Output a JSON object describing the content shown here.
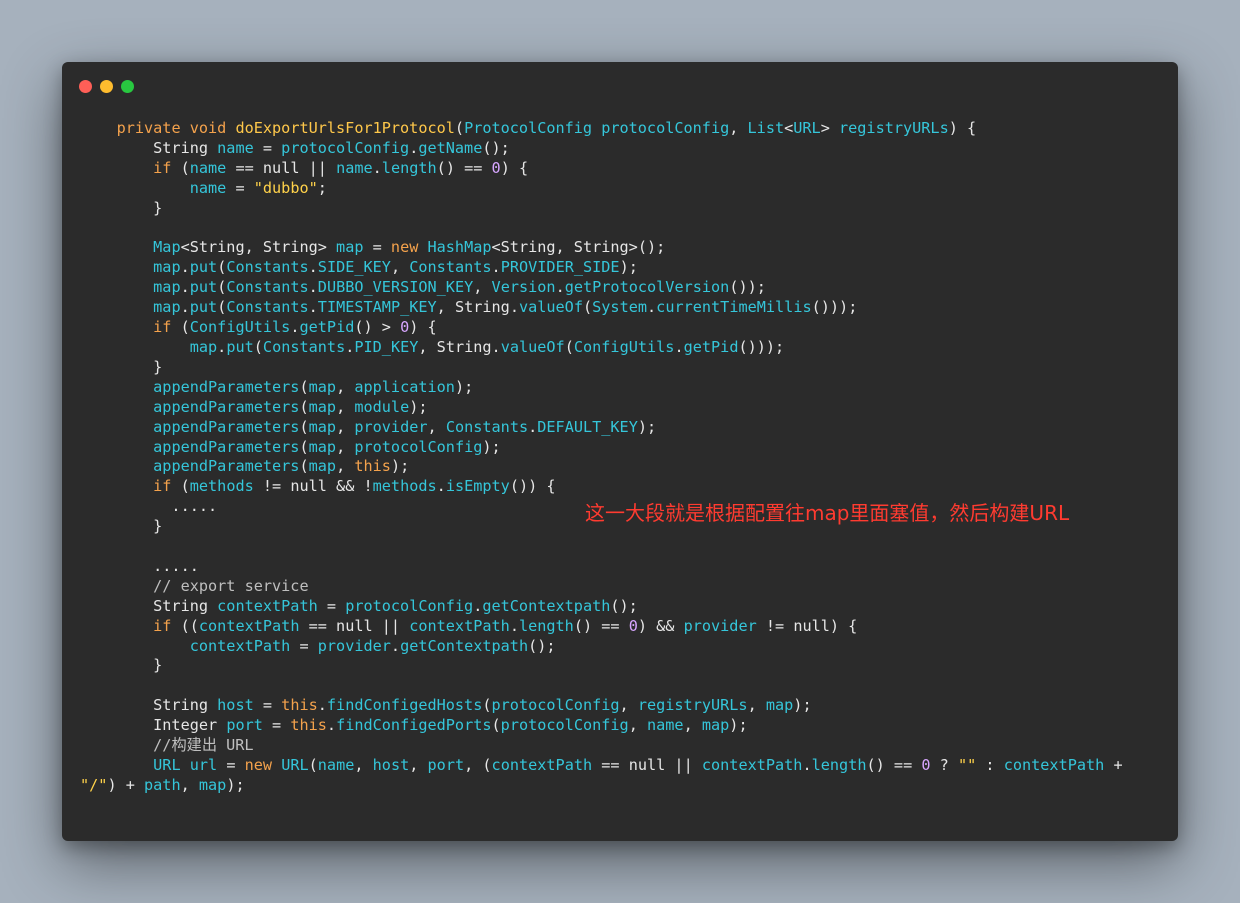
{
  "window": {
    "dots": [
      {
        "name": "close-dot",
        "color": "#ff5f57"
      },
      {
        "name": "minimize-dot",
        "color": "#febc2e"
      },
      {
        "name": "maximize-dot",
        "color": "#28c840"
      }
    ]
  },
  "annotation": "这一大段就是根据配置往map里面塞值，然后构建URL",
  "code_lines": [
    [
      [
        "p",
        "    "
      ],
      [
        "k",
        "private void "
      ],
      [
        "f",
        "doExportUrlsFor1Protocol"
      ],
      [
        "p",
        "("
      ],
      [
        "t",
        "ProtocolConfig protocolConfig"
      ],
      [
        "p",
        ", "
      ],
      [
        "t",
        "List"
      ],
      [
        "p",
        "<"
      ],
      [
        "t",
        "URL"
      ],
      [
        "p",
        "> "
      ],
      [
        "t",
        "registryURLs"
      ],
      [
        "p",
        ") {"
      ]
    ],
    [
      [
        "p",
        "        String "
      ],
      [
        "t",
        "name"
      ],
      [
        "p",
        " = "
      ],
      [
        "t",
        "protocolConfig"
      ],
      [
        "p",
        "."
      ],
      [
        "t",
        "getName"
      ],
      [
        "p",
        "();"
      ]
    ],
    [
      [
        "p",
        "        "
      ],
      [
        "k",
        "if"
      ],
      [
        "p",
        " ("
      ],
      [
        "t",
        "name"
      ],
      [
        "p",
        " == null || "
      ],
      [
        "t",
        "name"
      ],
      [
        "p",
        "."
      ],
      [
        "t",
        "length"
      ],
      [
        "p",
        "() == "
      ],
      [
        "n",
        "0"
      ],
      [
        "p",
        ") {"
      ]
    ],
    [
      [
        "p",
        "            "
      ],
      [
        "t",
        "name"
      ],
      [
        "p",
        " = "
      ],
      [
        "s",
        "\"dubbo\""
      ],
      [
        "p",
        ";"
      ]
    ],
    [
      [
        "p",
        "        }"
      ]
    ],
    [
      [
        "p",
        ""
      ]
    ],
    [
      [
        "p",
        "        "
      ],
      [
        "t",
        "Map"
      ],
      [
        "p",
        "<String, String> "
      ],
      [
        "t",
        "map"
      ],
      [
        "p",
        " = "
      ],
      [
        "k",
        "new "
      ],
      [
        "t",
        "HashMap"
      ],
      [
        "p",
        "<String, String>();"
      ]
    ],
    [
      [
        "p",
        "        "
      ],
      [
        "t",
        "map"
      ],
      [
        "p",
        "."
      ],
      [
        "t",
        "put"
      ],
      [
        "p",
        "("
      ],
      [
        "t",
        "Constants"
      ],
      [
        "p",
        "."
      ],
      [
        "t",
        "SIDE_KEY"
      ],
      [
        "p",
        ", "
      ],
      [
        "t",
        "Constants"
      ],
      [
        "p",
        "."
      ],
      [
        "t",
        "PROVIDER_SIDE"
      ],
      [
        "p",
        ");"
      ]
    ],
    [
      [
        "p",
        "        "
      ],
      [
        "t",
        "map"
      ],
      [
        "p",
        "."
      ],
      [
        "t",
        "put"
      ],
      [
        "p",
        "("
      ],
      [
        "t",
        "Constants"
      ],
      [
        "p",
        "."
      ],
      [
        "t",
        "DUBBO_VERSION_KEY"
      ],
      [
        "p",
        ", "
      ],
      [
        "t",
        "Version"
      ],
      [
        "p",
        "."
      ],
      [
        "t",
        "getProtocolVersion"
      ],
      [
        "p",
        "());"
      ]
    ],
    [
      [
        "p",
        "        "
      ],
      [
        "t",
        "map"
      ],
      [
        "p",
        "."
      ],
      [
        "t",
        "put"
      ],
      [
        "p",
        "("
      ],
      [
        "t",
        "Constants"
      ],
      [
        "p",
        "."
      ],
      [
        "t",
        "TIMESTAMP_KEY"
      ],
      [
        "p",
        ", String."
      ],
      [
        "t",
        "valueOf"
      ],
      [
        "p",
        "("
      ],
      [
        "t",
        "System"
      ],
      [
        "p",
        "."
      ],
      [
        "t",
        "currentTimeMillis"
      ],
      [
        "p",
        "()));"
      ]
    ],
    [
      [
        "p",
        "        "
      ],
      [
        "k",
        "if"
      ],
      [
        "p",
        " ("
      ],
      [
        "t",
        "ConfigUtils"
      ],
      [
        "p",
        "."
      ],
      [
        "t",
        "getPid"
      ],
      [
        "p",
        "() > "
      ],
      [
        "n",
        "0"
      ],
      [
        "p",
        ") {"
      ]
    ],
    [
      [
        "p",
        "            "
      ],
      [
        "t",
        "map"
      ],
      [
        "p",
        "."
      ],
      [
        "t",
        "put"
      ],
      [
        "p",
        "("
      ],
      [
        "t",
        "Constants"
      ],
      [
        "p",
        "."
      ],
      [
        "t",
        "PID_KEY"
      ],
      [
        "p",
        ", String."
      ],
      [
        "t",
        "valueOf"
      ],
      [
        "p",
        "("
      ],
      [
        "t",
        "ConfigUtils"
      ],
      [
        "p",
        "."
      ],
      [
        "t",
        "getPid"
      ],
      [
        "p",
        "()));"
      ]
    ],
    [
      [
        "p",
        "        }"
      ]
    ],
    [
      [
        "p",
        "        "
      ],
      [
        "t",
        "appendParameters"
      ],
      [
        "p",
        "("
      ],
      [
        "t",
        "map"
      ],
      [
        "p",
        ", "
      ],
      [
        "t",
        "application"
      ],
      [
        "p",
        ");"
      ]
    ],
    [
      [
        "p",
        "        "
      ],
      [
        "t",
        "appendParameters"
      ],
      [
        "p",
        "("
      ],
      [
        "t",
        "map"
      ],
      [
        "p",
        ", "
      ],
      [
        "t",
        "module"
      ],
      [
        "p",
        ");"
      ]
    ],
    [
      [
        "p",
        "        "
      ],
      [
        "t",
        "appendParameters"
      ],
      [
        "p",
        "("
      ],
      [
        "t",
        "map"
      ],
      [
        "p",
        ", "
      ],
      [
        "t",
        "provider"
      ],
      [
        "p",
        ", "
      ],
      [
        "t",
        "Constants"
      ],
      [
        "p",
        "."
      ],
      [
        "t",
        "DEFAULT_KEY"
      ],
      [
        "p",
        ");"
      ]
    ],
    [
      [
        "p",
        "        "
      ],
      [
        "t",
        "appendParameters"
      ],
      [
        "p",
        "("
      ],
      [
        "t",
        "map"
      ],
      [
        "p",
        ", "
      ],
      [
        "t",
        "protocolConfig"
      ],
      [
        "p",
        ");"
      ]
    ],
    [
      [
        "p",
        "        "
      ],
      [
        "t",
        "appendParameters"
      ],
      [
        "p",
        "("
      ],
      [
        "t",
        "map"
      ],
      [
        "p",
        ", "
      ],
      [
        "k",
        "this"
      ],
      [
        "p",
        ");"
      ]
    ],
    [
      [
        "p",
        "        "
      ],
      [
        "k",
        "if"
      ],
      [
        "p",
        " ("
      ],
      [
        "t",
        "methods"
      ],
      [
        "p",
        " != null && !"
      ],
      [
        "t",
        "methods"
      ],
      [
        "p",
        "."
      ],
      [
        "t",
        "isEmpty"
      ],
      [
        "p",
        "()) {"
      ]
    ],
    [
      [
        "p",
        "          ....."
      ]
    ],
    [
      [
        "p",
        "        }"
      ]
    ],
    [
      [
        "p",
        ""
      ]
    ],
    [
      [
        "p",
        "        ....."
      ]
    ],
    [
      [
        "p",
        "        "
      ],
      [
        "c",
        "// export service"
      ]
    ],
    [
      [
        "p",
        "        String "
      ],
      [
        "t",
        "contextPath"
      ],
      [
        "p",
        " = "
      ],
      [
        "t",
        "protocolConfig"
      ],
      [
        "p",
        "."
      ],
      [
        "t",
        "getContextpath"
      ],
      [
        "p",
        "();"
      ]
    ],
    [
      [
        "p",
        "        "
      ],
      [
        "k",
        "if"
      ],
      [
        "p",
        " (("
      ],
      [
        "t",
        "contextPath"
      ],
      [
        "p",
        " == null || "
      ],
      [
        "t",
        "contextPath"
      ],
      [
        "p",
        "."
      ],
      [
        "t",
        "length"
      ],
      [
        "p",
        "() == "
      ],
      [
        "n",
        "0"
      ],
      [
        "p",
        ") && "
      ],
      [
        "t",
        "provider"
      ],
      [
        "p",
        " != null) {"
      ]
    ],
    [
      [
        "p",
        "            "
      ],
      [
        "t",
        "contextPath"
      ],
      [
        "p",
        " = "
      ],
      [
        "t",
        "provider"
      ],
      [
        "p",
        "."
      ],
      [
        "t",
        "getContextpath"
      ],
      [
        "p",
        "();"
      ]
    ],
    [
      [
        "p",
        "        }"
      ]
    ],
    [
      [
        "p",
        ""
      ]
    ],
    [
      [
        "p",
        "        String "
      ],
      [
        "t",
        "host"
      ],
      [
        "p",
        " = "
      ],
      [
        "k",
        "this"
      ],
      [
        "p",
        "."
      ],
      [
        "t",
        "findConfigedHosts"
      ],
      [
        "p",
        "("
      ],
      [
        "t",
        "protocolConfig"
      ],
      [
        "p",
        ", "
      ],
      [
        "t",
        "registryURLs"
      ],
      [
        "p",
        ", "
      ],
      [
        "t",
        "map"
      ],
      [
        "p",
        ");"
      ]
    ],
    [
      [
        "p",
        "        Integer "
      ],
      [
        "t",
        "port"
      ],
      [
        "p",
        " = "
      ],
      [
        "k",
        "this"
      ],
      [
        "p",
        "."
      ],
      [
        "t",
        "findConfigedPorts"
      ],
      [
        "p",
        "("
      ],
      [
        "t",
        "protocolConfig"
      ],
      [
        "p",
        ", "
      ],
      [
        "t",
        "name"
      ],
      [
        "p",
        ", "
      ],
      [
        "t",
        "map"
      ],
      [
        "p",
        ");"
      ]
    ],
    [
      [
        "p",
        "        "
      ],
      [
        "c",
        "//构建出 URL"
      ]
    ],
    [
      [
        "p",
        "        "
      ],
      [
        "t",
        "URL url"
      ],
      [
        "p",
        " = "
      ],
      [
        "k",
        "new "
      ],
      [
        "t",
        "URL"
      ],
      [
        "p",
        "("
      ],
      [
        "t",
        "name"
      ],
      [
        "p",
        ", "
      ],
      [
        "t",
        "host"
      ],
      [
        "p",
        ", "
      ],
      [
        "t",
        "port"
      ],
      [
        "p",
        ", ("
      ],
      [
        "t",
        "contextPath"
      ],
      [
        "p",
        " == null || "
      ],
      [
        "t",
        "contextPath"
      ],
      [
        "p",
        "."
      ],
      [
        "t",
        "length"
      ],
      [
        "p",
        "() == "
      ],
      [
        "n",
        "0"
      ],
      [
        "p",
        " ? "
      ],
      [
        "s",
        "\"\""
      ],
      [
        "p",
        " : "
      ],
      [
        "t",
        "contextPath"
      ],
      [
        "p",
        " +"
      ]
    ],
    [
      [
        "s",
        "\"/\""
      ],
      [
        "p",
        ") + "
      ],
      [
        "t",
        "path"
      ],
      [
        "p",
        ", "
      ],
      [
        "t",
        "map"
      ],
      [
        "p",
        ");"
      ]
    ]
  ]
}
